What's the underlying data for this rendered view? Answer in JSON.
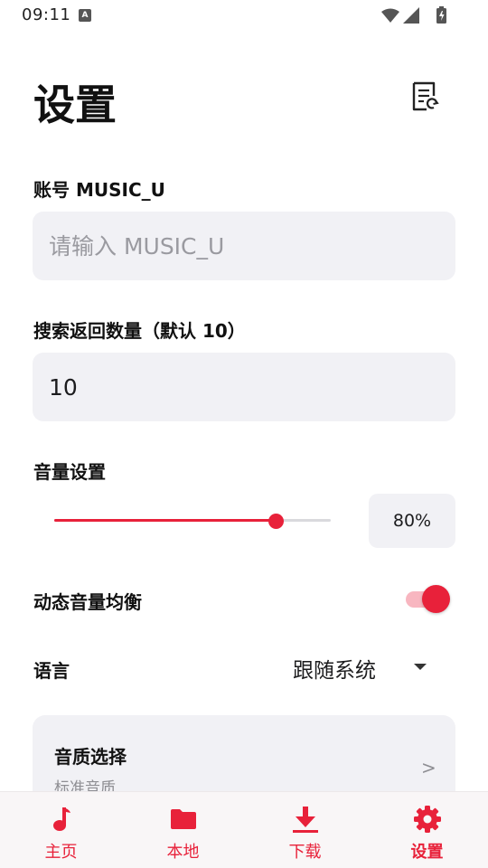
{
  "status_bar": {
    "time": "09:11",
    "notification_glyph": "A",
    "icons": [
      "wifi-icon",
      "signal-icon",
      "battery-charging-icon"
    ]
  },
  "header": {
    "title": "设置",
    "action_icon": "document-refresh-icon"
  },
  "account": {
    "label": "账号 MUSIC_U",
    "value": "",
    "placeholder": "请输入 MUSIC_U"
  },
  "search_count": {
    "label": "搜索返回数量（默认 10）",
    "value": "10"
  },
  "volume": {
    "label": "音量设置",
    "level": 0.8,
    "display": "80%"
  },
  "dynamic_volume": {
    "label": "动态音量均衡",
    "enabled": true
  },
  "language": {
    "label": "语言",
    "selected": "跟随系统"
  },
  "quality": {
    "title": "音质选择",
    "subtitle": "标准音质",
    "chevron": ">"
  },
  "bottom_nav": {
    "items": [
      {
        "label": "主页",
        "icon": "music-note-icon",
        "active": false
      },
      {
        "label": "本地",
        "icon": "folder-icon",
        "active": false
      },
      {
        "label": "下载",
        "icon": "download-icon",
        "active": false
      },
      {
        "label": "设置",
        "icon": "gear-icon",
        "active": true
      }
    ]
  },
  "colors": {
    "accent": "#e8213a",
    "accent_light": "#f8b6c0",
    "field_background": "#f1f1f5"
  }
}
